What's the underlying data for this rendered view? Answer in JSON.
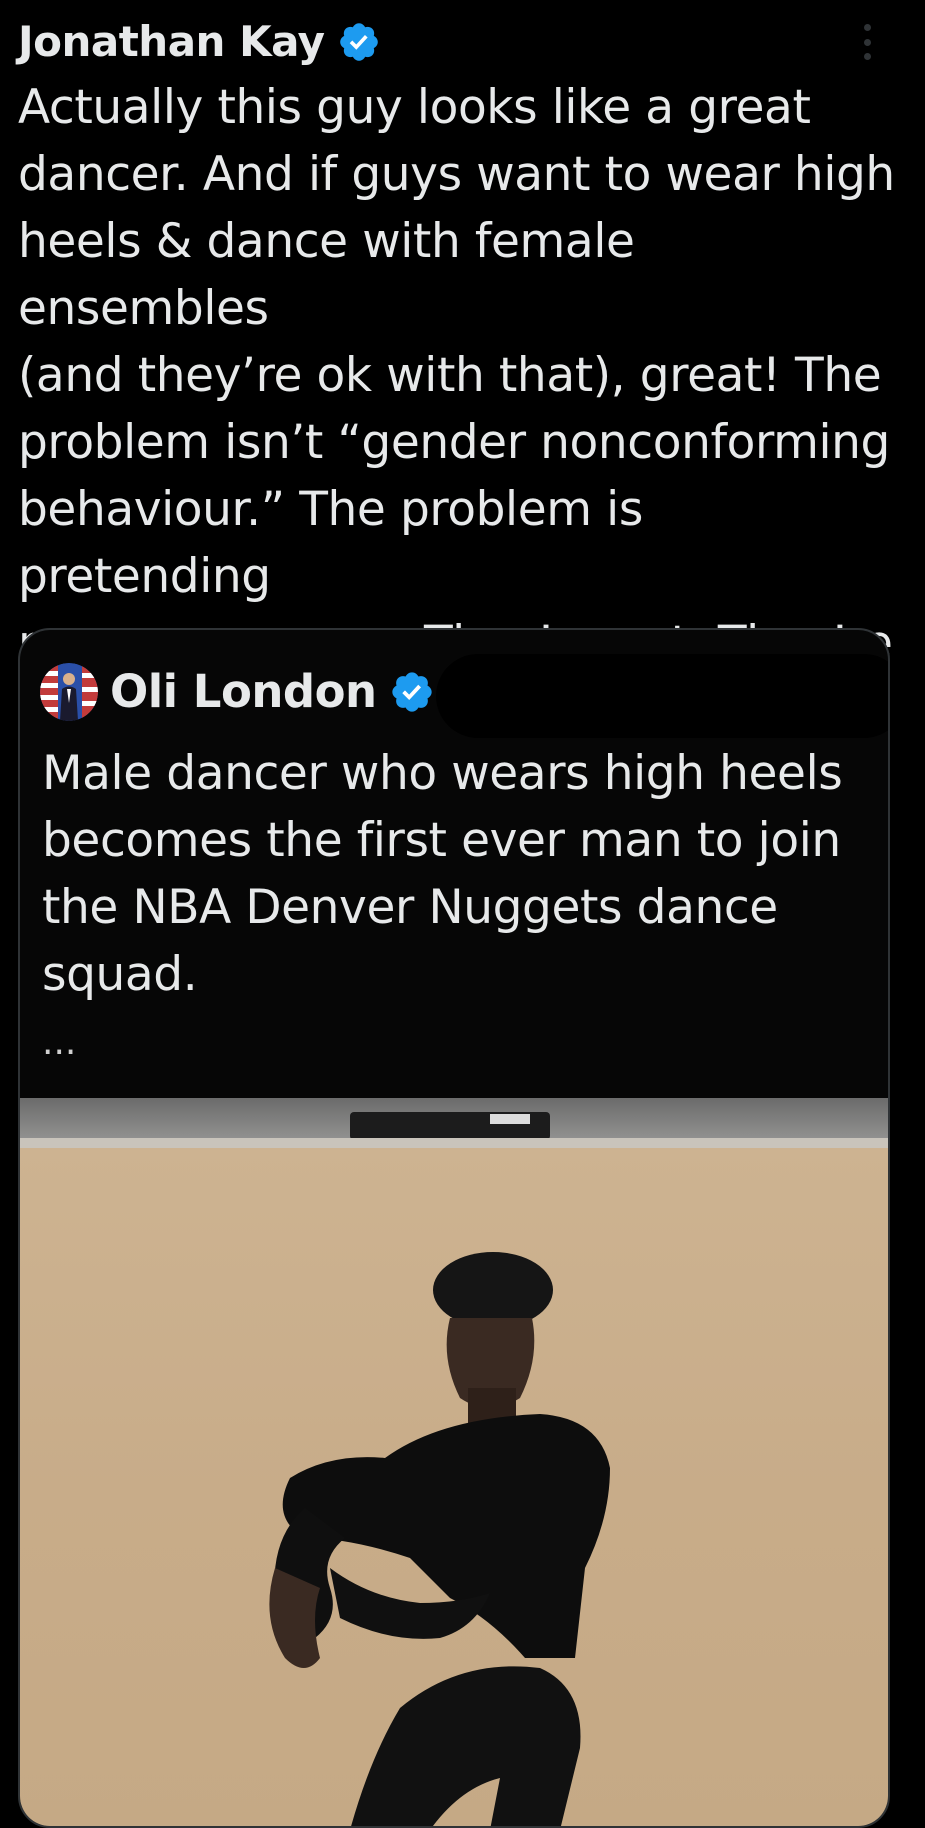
{
  "tweet": {
    "author_name": "Jonathan Kay",
    "verified_icon": "verified-badge-icon",
    "text": "Actually this guy looks like a great\ndancer. And if guys want to wear high\nheels & dance with female ensembles\n(and they’re ok with that), great! The\nproblem isn’t “gender nonconforming\nbehaviour.” The problem is pretending\nmen are women. They’re not. They’re\nmen in high heels"
  },
  "quoted_tweet": {
    "author_name": "Oli London",
    "verified_icon": "verified-badge-icon",
    "text": "Male dancer who wears high heels\nbecomes the first ever man to join\nthe NBA Denver Nuggets dance\nsquad.",
    "ellipsis": "..."
  },
  "colors": {
    "background": "#000000",
    "text": "#e7e9ea",
    "verified_blue": "#1d9bf0",
    "card_border": "#2f3336",
    "wall": "#c9ae8c"
  }
}
